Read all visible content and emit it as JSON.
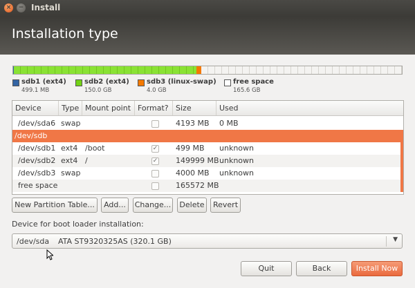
{
  "window": {
    "title": "Install",
    "close_glyph": "×",
    "minimize_glyph": "−"
  },
  "header": {
    "title": "Installation type"
  },
  "partition_bar": {
    "segments": [
      {
        "name": "sdb1",
        "fraction": 0.0015,
        "color": "#3465a4"
      },
      {
        "name": "sdb2",
        "fraction": 0.4687,
        "color": "#8ae234"
      },
      {
        "name": "sdb3",
        "fraction": 0.0125,
        "color": "#f57900"
      },
      {
        "name": "free space",
        "fraction": 0.5173,
        "color": "#f4f3f1"
      }
    ]
  },
  "legend": [
    {
      "label": "sdb1 (ext4)",
      "size": "499.1 MB",
      "color": "#3465a4"
    },
    {
      "label": "sdb2 (ext4)",
      "size": "150.0 GB",
      "color": "#73d216"
    },
    {
      "label": "sdb3 (linux-swap)",
      "size": "4.0 GB",
      "color": "#f57900"
    },
    {
      "label": "free space",
      "size": "165.6 GB",
      "color": "#ffffff"
    }
  ],
  "table": {
    "columns": [
      "Device",
      "Type",
      "Mount point",
      "Format?",
      "Size",
      "Used"
    ],
    "rows": [
      {
        "device": "/dev/sda6",
        "type": "swap",
        "mount": "",
        "format": false,
        "size": "4193 MB",
        "used": "0 MB"
      },
      {
        "device": "/dev/sdb",
        "type": "",
        "mount": "",
        "format": null,
        "size": "",
        "used": ""
      },
      {
        "device": "/dev/sdb1",
        "type": "ext4",
        "mount": "/boot",
        "format": true,
        "size": "499 MB",
        "used": "unknown"
      },
      {
        "device": "/dev/sdb2",
        "type": "ext4",
        "mount": "/",
        "format": true,
        "size": "149999 MB",
        "used": "unknown"
      },
      {
        "device": "/dev/sdb3",
        "type": "swap",
        "mount": "",
        "format": false,
        "size": "4000 MB",
        "used": "unknown"
      },
      {
        "device": "free space",
        "type": "",
        "mount": "",
        "format": false,
        "size": "165572 MB",
        "used": ""
      }
    ],
    "check_glyph": "✓"
  },
  "buttons": {
    "new_table": "New Partition Table...",
    "add": "Add...",
    "change": "Change...",
    "delete": "Delete",
    "revert": "Revert"
  },
  "bootloader": {
    "label": "Device for boot loader installation:",
    "device": "/dev/sda",
    "model": "ATA ST9320325AS (320.1 GB)",
    "arrow": "▼"
  },
  "footer": {
    "quit": "Quit",
    "back": "Back",
    "install": "Install Now"
  },
  "colors": {
    "accent": "#f07746",
    "titlebar": "#3c3b37"
  }
}
